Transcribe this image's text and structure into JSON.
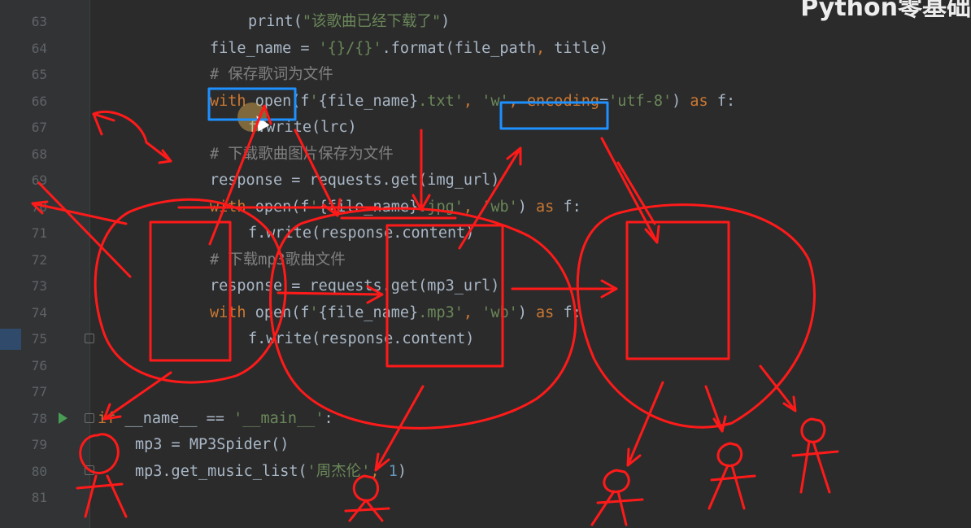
{
  "overlay_title": "Python零基础",
  "code_lines": [
    {
      "n": "63",
      "indent": 3,
      "parts": [
        [
          "fn",
          "print("
        ],
        [
          "str",
          "\"该歌曲已经下载了\""
        ],
        [
          "fn",
          ")"
        ]
      ]
    },
    {
      "n": "64",
      "indent": 2,
      "parts": [
        [
          "fn",
          "file_name = "
        ],
        [
          "str",
          "'{}/{}'"
        ],
        [
          "fn",
          ".format(file_path"
        ],
        [
          "kw",
          ", "
        ],
        [
          "fn",
          "title)"
        ]
      ]
    },
    {
      "n": "65",
      "indent": 2,
      "parts": [
        [
          "cmt",
          "# 保存歌词为文件"
        ]
      ]
    },
    {
      "n": "66",
      "indent": 2,
      "parts": [
        [
          "kw",
          "with "
        ],
        [
          "fn",
          "open(f"
        ],
        [
          "str",
          "'"
        ],
        [
          "fn",
          "{file_name}"
        ],
        [
          "str",
          ".txt'"
        ],
        [
          "kw",
          ", "
        ],
        [
          "str",
          "'w'"
        ],
        [
          "kw",
          ", "
        ],
        [
          "kw",
          "encoding"
        ],
        [
          "fn",
          "="
        ],
        [
          "str",
          "'utf-8'"
        ],
        [
          "fn",
          ") "
        ],
        [
          "kw",
          "as "
        ],
        [
          "fn",
          "f:"
        ]
      ]
    },
    {
      "n": "67",
      "indent": 3,
      "parts": [
        [
          "fn",
          "f.write(lrc)"
        ]
      ]
    },
    {
      "n": "68",
      "indent": 2,
      "parts": [
        [
          "cmt",
          "# 下载歌曲图片保存为文件"
        ]
      ]
    },
    {
      "n": "69",
      "indent": 2,
      "parts": [
        [
          "fn",
          "response = requests.get(img_url)"
        ]
      ]
    },
    {
      "n": "70",
      "indent": 2,
      "parts": [
        [
          "kw",
          "with "
        ],
        [
          "fn",
          "open(f"
        ],
        [
          "str",
          "'"
        ],
        [
          "fn",
          "{file_name}"
        ],
        [
          "str",
          ".jpg'"
        ],
        [
          "kw",
          ", "
        ],
        [
          "str",
          "'wb'"
        ],
        [
          "fn",
          ") "
        ],
        [
          "kw",
          "as "
        ],
        [
          "fn",
          "f:"
        ]
      ]
    },
    {
      "n": "71",
      "indent": 3,
      "parts": [
        [
          "fn",
          "f.write(response.content)"
        ]
      ]
    },
    {
      "n": "72",
      "indent": 2,
      "parts": [
        [
          "cmt",
          "# 下载mp3歌曲文件"
        ]
      ]
    },
    {
      "n": "73",
      "indent": 2,
      "parts": [
        [
          "fn",
          "response = requests.get(mp3_url)"
        ]
      ]
    },
    {
      "n": "74",
      "indent": 2,
      "parts": [
        [
          "kw",
          "with "
        ],
        [
          "fn",
          "open(f"
        ],
        [
          "str",
          "'"
        ],
        [
          "fn",
          "{file_name}"
        ],
        [
          "str",
          ".mp3'"
        ],
        [
          "kw",
          ", "
        ],
        [
          "str",
          "'wb'"
        ],
        [
          "fn",
          ") "
        ],
        [
          "kw",
          "as "
        ],
        [
          "fn",
          "f:"
        ]
      ]
    },
    {
      "n": "75",
      "indent": 3,
      "parts": [
        [
          "fn",
          "f.write(response.content)"
        ]
      ]
    },
    {
      "n": "76",
      "indent": 0,
      "parts": []
    },
    {
      "n": "77",
      "indent": 0,
      "parts": []
    },
    {
      "n": "78",
      "indent": 0,
      "parts": [
        [
          "kw",
          "if "
        ],
        [
          "fn",
          "__name__ == "
        ],
        [
          "str",
          "'__main__'"
        ],
        [
          "fn",
          ":"
        ]
      ]
    },
    {
      "n": "79",
      "indent": 1,
      "parts": [
        [
          "fn",
          "mp3 = MP3Spider()"
        ]
      ]
    },
    {
      "n": "80",
      "indent": 1,
      "parts": [
        [
          "fn",
          "mp3.get_music_list("
        ],
        [
          "str",
          "'周杰伦'"
        ],
        [
          "kw",
          ", "
        ],
        [
          "num",
          "1"
        ],
        [
          "fn",
          ")"
        ]
      ]
    },
    {
      "n": "81",
      "indent": 0,
      "parts": []
    }
  ],
  "colors": {
    "background": "#2b2b2b",
    "annotation_red": "#ff1a1a",
    "highlight_blue": "#1e90ff"
  }
}
